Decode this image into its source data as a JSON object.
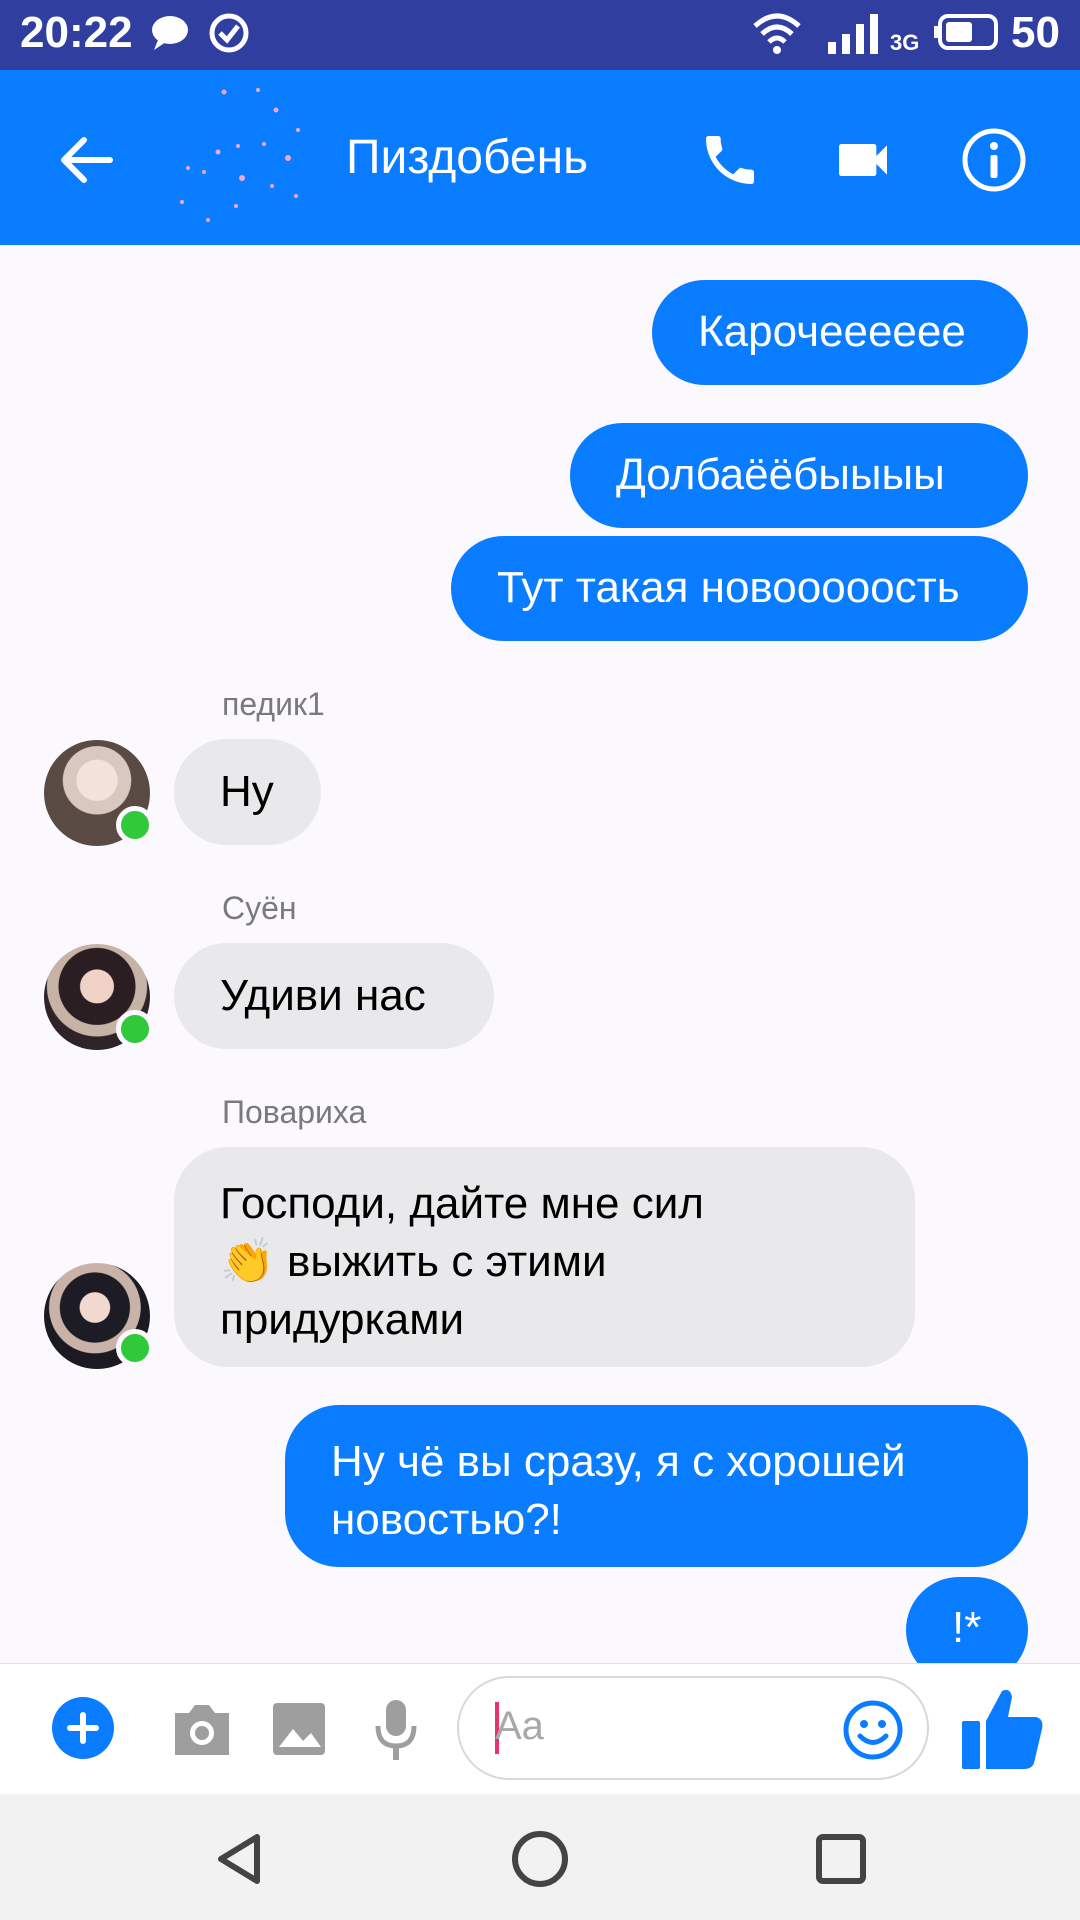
{
  "status_bar": {
    "time": "20:22",
    "network": "3G",
    "battery": "50"
  },
  "header": {
    "title": "Пиздобень"
  },
  "messages": [
    {
      "type": "outgoing",
      "text": "Карочееееее"
    },
    {
      "type": "outgoing",
      "text": "Долбаёёбыыыы"
    },
    {
      "type": "outgoing",
      "text": "Тут такая новооооость"
    },
    {
      "type": "incoming",
      "sender": "педик1",
      "text": "Ну"
    },
    {
      "type": "incoming",
      "sender": "Суён",
      "text": "Удиви нас"
    },
    {
      "type": "incoming",
      "sender": "Повариха",
      "line1": "Господи, дайте мне сил",
      "line2": "👏 выжить с этими",
      "line3": "придурками"
    },
    {
      "type": "outgoing",
      "line1": "Ну чё вы сразу, я с хорошей",
      "line2": "новостью?!"
    },
    {
      "type": "outgoing",
      "text": "!*"
    }
  ],
  "composer": {
    "placeholder": "Aa"
  },
  "colors": {
    "accent": "#0a7cff",
    "status_bar": "#303f9f",
    "incoming_bubble": "#e9e8ea",
    "online": "#30c93a"
  },
  "icons": [
    "back-arrow-icon",
    "phone-icon",
    "video-camera-icon",
    "info-icon",
    "plus-icon",
    "camera-icon",
    "image-icon",
    "microphone-icon",
    "emoji-icon",
    "thumbs-up-icon"
  ]
}
